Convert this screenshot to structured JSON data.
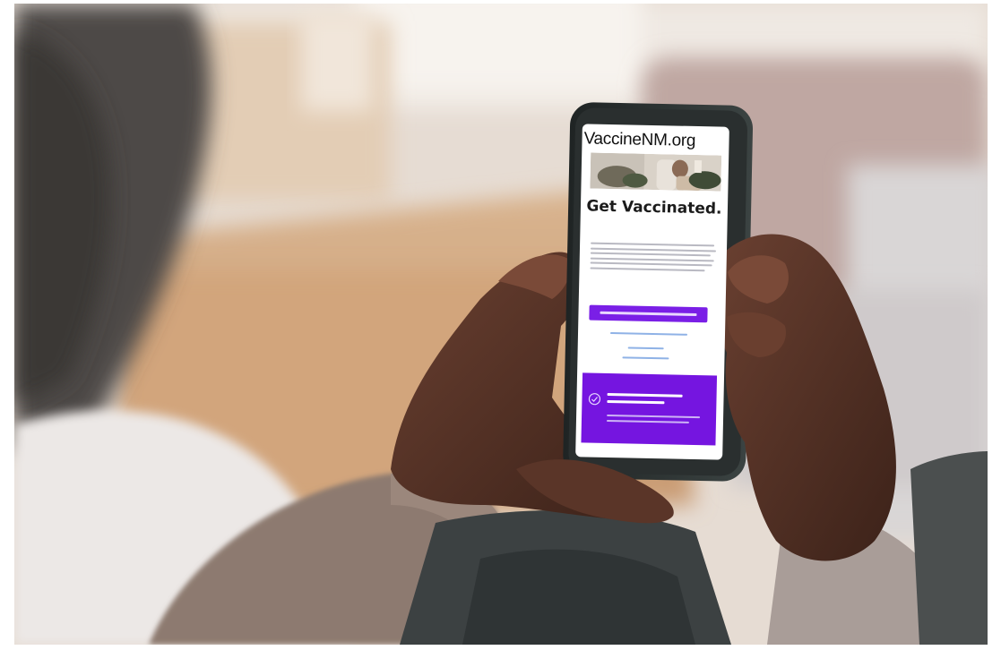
{
  "site": {
    "domain": "VaccineNM.org",
    "headline": "Get Vaccinated."
  },
  "icons": {
    "card_icon": "check-circle-icon"
  },
  "colors": {
    "accent_purple": "#7515e0",
    "button_purple": "#7a1fe6",
    "link_blue": "#8fb2e6"
  }
}
